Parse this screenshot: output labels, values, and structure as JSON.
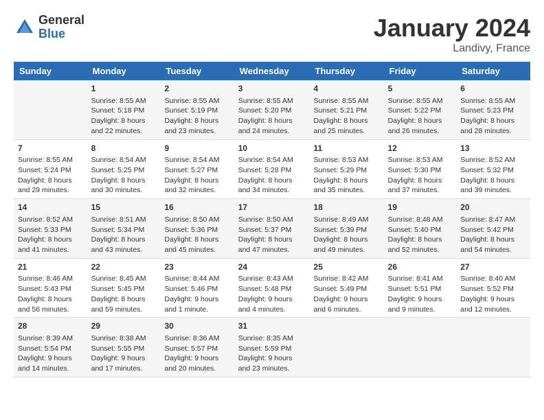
{
  "header": {
    "logo_general": "General",
    "logo_blue": "Blue",
    "title": "January 2024",
    "subtitle": "Landivy, France"
  },
  "calendar": {
    "days_of_week": [
      "Sunday",
      "Monday",
      "Tuesday",
      "Wednesday",
      "Thursday",
      "Friday",
      "Saturday"
    ],
    "weeks": [
      [
        {
          "day": "",
          "sunrise": "",
          "sunset": "",
          "daylight": ""
        },
        {
          "day": "1",
          "sunrise": "Sunrise: 8:55 AM",
          "sunset": "Sunset: 5:18 PM",
          "daylight": "Daylight: 8 hours and 22 minutes."
        },
        {
          "day": "2",
          "sunrise": "Sunrise: 8:55 AM",
          "sunset": "Sunset: 5:19 PM",
          "daylight": "Daylight: 8 hours and 23 minutes."
        },
        {
          "day": "3",
          "sunrise": "Sunrise: 8:55 AM",
          "sunset": "Sunset: 5:20 PM",
          "daylight": "Daylight: 8 hours and 24 minutes."
        },
        {
          "day": "4",
          "sunrise": "Sunrise: 8:55 AM",
          "sunset": "Sunset: 5:21 PM",
          "daylight": "Daylight: 8 hours and 25 minutes."
        },
        {
          "day": "5",
          "sunrise": "Sunrise: 8:55 AM",
          "sunset": "Sunset: 5:22 PM",
          "daylight": "Daylight: 8 hours and 26 minutes."
        },
        {
          "day": "6",
          "sunrise": "Sunrise: 8:55 AM",
          "sunset": "Sunset: 5:23 PM",
          "daylight": "Daylight: 8 hours and 28 minutes."
        }
      ],
      [
        {
          "day": "7",
          "sunrise": "Sunrise: 8:55 AM",
          "sunset": "Sunset: 5:24 PM",
          "daylight": "Daylight: 8 hours and 29 minutes."
        },
        {
          "day": "8",
          "sunrise": "Sunrise: 8:54 AM",
          "sunset": "Sunset: 5:25 PM",
          "daylight": "Daylight: 8 hours and 30 minutes."
        },
        {
          "day": "9",
          "sunrise": "Sunrise: 8:54 AM",
          "sunset": "Sunset: 5:27 PM",
          "daylight": "Daylight: 8 hours and 32 minutes."
        },
        {
          "day": "10",
          "sunrise": "Sunrise: 8:54 AM",
          "sunset": "Sunset: 5:28 PM",
          "daylight": "Daylight: 8 hours and 34 minutes."
        },
        {
          "day": "11",
          "sunrise": "Sunrise: 8:53 AM",
          "sunset": "Sunset: 5:29 PM",
          "daylight": "Daylight: 8 hours and 35 minutes."
        },
        {
          "day": "12",
          "sunrise": "Sunrise: 8:53 AM",
          "sunset": "Sunset: 5:30 PM",
          "daylight": "Daylight: 8 hours and 37 minutes."
        },
        {
          "day": "13",
          "sunrise": "Sunrise: 8:52 AM",
          "sunset": "Sunset: 5:32 PM",
          "daylight": "Daylight: 8 hours and 39 minutes."
        }
      ],
      [
        {
          "day": "14",
          "sunrise": "Sunrise: 8:52 AM",
          "sunset": "Sunset: 5:33 PM",
          "daylight": "Daylight: 8 hours and 41 minutes."
        },
        {
          "day": "15",
          "sunrise": "Sunrise: 8:51 AM",
          "sunset": "Sunset: 5:34 PM",
          "daylight": "Daylight: 8 hours and 43 minutes."
        },
        {
          "day": "16",
          "sunrise": "Sunrise: 8:50 AM",
          "sunset": "Sunset: 5:36 PM",
          "daylight": "Daylight: 8 hours and 45 minutes."
        },
        {
          "day": "17",
          "sunrise": "Sunrise: 8:50 AM",
          "sunset": "Sunset: 5:37 PM",
          "daylight": "Daylight: 8 hours and 47 minutes."
        },
        {
          "day": "18",
          "sunrise": "Sunrise: 8:49 AM",
          "sunset": "Sunset: 5:39 PM",
          "daylight": "Daylight: 8 hours and 49 minutes."
        },
        {
          "day": "19",
          "sunrise": "Sunrise: 8:48 AM",
          "sunset": "Sunset: 5:40 PM",
          "daylight": "Daylight: 8 hours and 52 minutes."
        },
        {
          "day": "20",
          "sunrise": "Sunrise: 8:47 AM",
          "sunset": "Sunset: 5:42 PM",
          "daylight": "Daylight: 8 hours and 54 minutes."
        }
      ],
      [
        {
          "day": "21",
          "sunrise": "Sunrise: 8:46 AM",
          "sunset": "Sunset: 5:43 PM",
          "daylight": "Daylight: 8 hours and 56 minutes."
        },
        {
          "day": "22",
          "sunrise": "Sunrise: 8:45 AM",
          "sunset": "Sunset: 5:45 PM",
          "daylight": "Daylight: 8 hours and 59 minutes."
        },
        {
          "day": "23",
          "sunrise": "Sunrise: 8:44 AM",
          "sunset": "Sunset: 5:46 PM",
          "daylight": "Daylight: 9 hours and 1 minute."
        },
        {
          "day": "24",
          "sunrise": "Sunrise: 8:43 AM",
          "sunset": "Sunset: 5:48 PM",
          "daylight": "Daylight: 9 hours and 4 minutes."
        },
        {
          "day": "25",
          "sunrise": "Sunrise: 8:42 AM",
          "sunset": "Sunset: 5:49 PM",
          "daylight": "Daylight: 9 hours and 6 minutes."
        },
        {
          "day": "26",
          "sunrise": "Sunrise: 8:41 AM",
          "sunset": "Sunset: 5:51 PM",
          "daylight": "Daylight: 9 hours and 9 minutes."
        },
        {
          "day": "27",
          "sunrise": "Sunrise: 8:40 AM",
          "sunset": "Sunset: 5:52 PM",
          "daylight": "Daylight: 9 hours and 12 minutes."
        }
      ],
      [
        {
          "day": "28",
          "sunrise": "Sunrise: 8:39 AM",
          "sunset": "Sunset: 5:54 PM",
          "daylight": "Daylight: 9 hours and 14 minutes."
        },
        {
          "day": "29",
          "sunrise": "Sunrise: 8:38 AM",
          "sunset": "Sunset: 5:55 PM",
          "daylight": "Daylight: 9 hours and 17 minutes."
        },
        {
          "day": "30",
          "sunrise": "Sunrise: 8:36 AM",
          "sunset": "Sunset: 5:57 PM",
          "daylight": "Daylight: 9 hours and 20 minutes."
        },
        {
          "day": "31",
          "sunrise": "Sunrise: 8:35 AM",
          "sunset": "Sunset: 5:59 PM",
          "daylight": "Daylight: 9 hours and 23 minutes."
        },
        {
          "day": "",
          "sunrise": "",
          "sunset": "",
          "daylight": ""
        },
        {
          "day": "",
          "sunrise": "",
          "sunset": "",
          "daylight": ""
        },
        {
          "day": "",
          "sunrise": "",
          "sunset": "",
          "daylight": ""
        }
      ]
    ]
  }
}
